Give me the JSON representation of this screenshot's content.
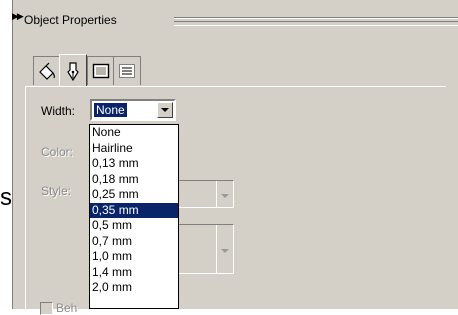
{
  "panel": {
    "title": "Object Properties",
    "stray_char": "s",
    "tabs": [
      {
        "icon": "fill-bucket-icon",
        "active": false
      },
      {
        "icon": "pen-nib-icon",
        "active": true
      },
      {
        "icon": "frame-icon",
        "active": false
      },
      {
        "icon": "text-paragraph-icon",
        "active": false
      }
    ]
  },
  "outline": {
    "width_label": "Width:",
    "width_value": "None",
    "color_label": "Color:",
    "style_label": "Style:",
    "behind_label": "Beh"
  },
  "width_options": [
    "None",
    "Hairline",
    "0,13 mm",
    "0,18 mm",
    "0,25 mm",
    "0,35 mm",
    "0,5 mm",
    "0,7 mm",
    "1,0 mm",
    "1,4 mm",
    "2,0 mm"
  ],
  "highlighted_option": "0,35 mm",
  "colors": {
    "panel_bg": "#d4d0c8",
    "selection": "#0a246a"
  }
}
